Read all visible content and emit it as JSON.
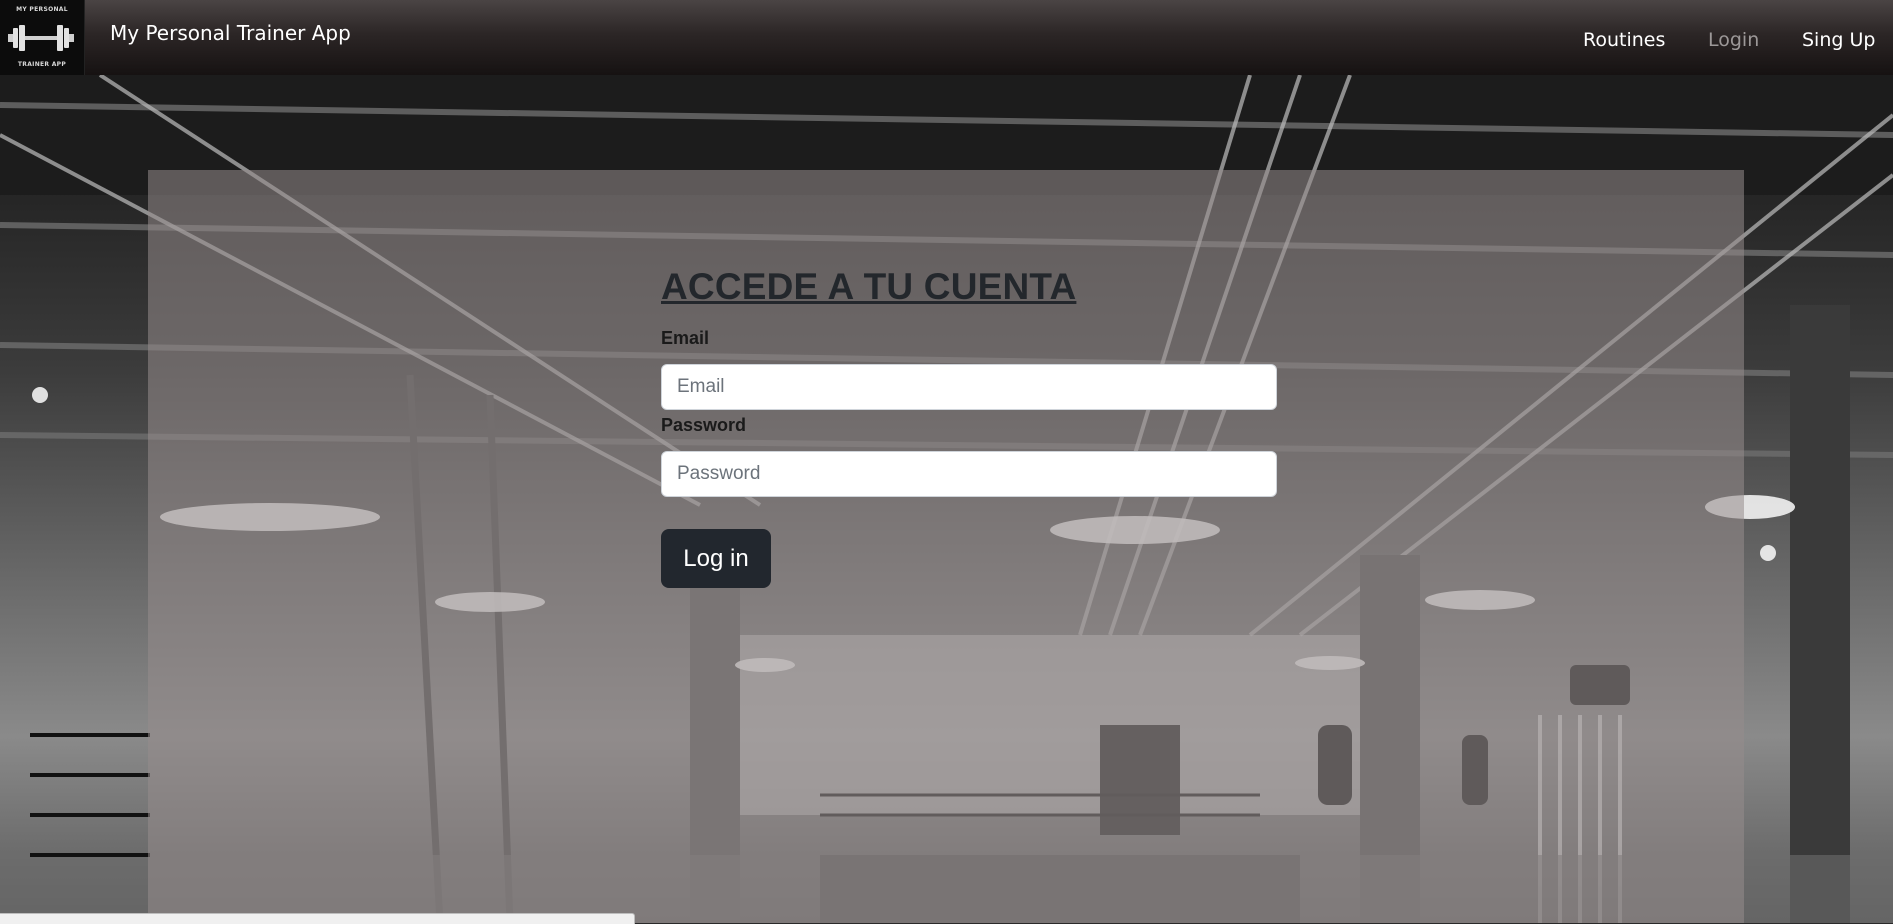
{
  "navbar": {
    "brand": "My Personal Trainer App",
    "logo_top": "MY PERSONAL",
    "logo_bottom": "TRAINER APP",
    "logo_icon": "dumbbell-icon",
    "links": [
      {
        "label": "Routines",
        "active": false
      },
      {
        "label": "Login",
        "active": true
      },
      {
        "label": "Sing Up",
        "active": false
      }
    ]
  },
  "login_form": {
    "title": "ACCEDE A TU CUENTA",
    "email_label": "Email",
    "email_placeholder": "Email",
    "email_value": "",
    "password_label": "Password",
    "password_placeholder": "Password",
    "password_value": "",
    "submit_label": "Log in"
  },
  "colors": {
    "navbar": "#2c2626",
    "button": "#22272e",
    "title": "#23272c",
    "muted_link": "#9c9898"
  }
}
